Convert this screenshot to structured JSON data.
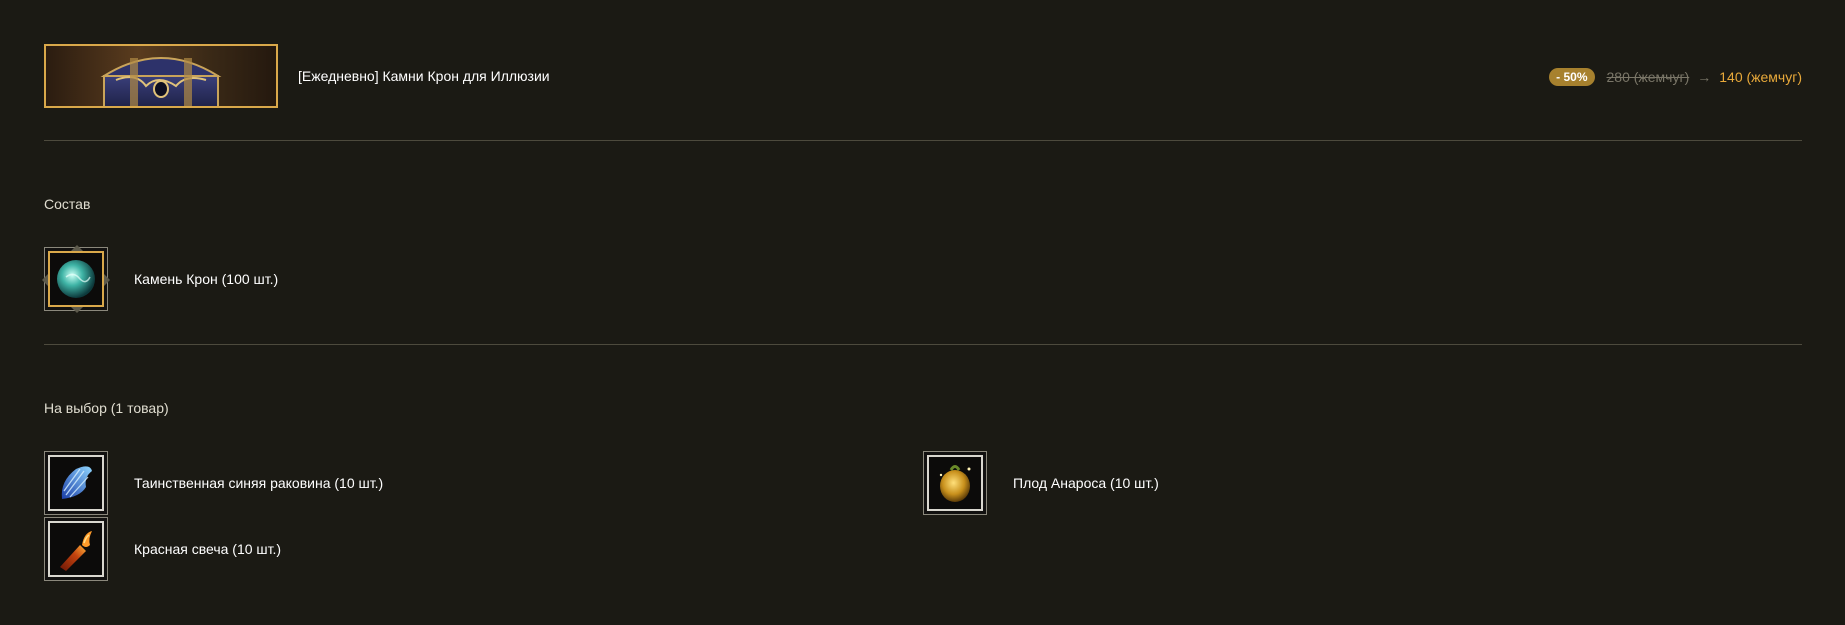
{
  "header": {
    "title": "[Ежедневно] Камни Крон для Иллюзии",
    "discount_badge": "- 50%",
    "old_price": "280 (жемчуг)",
    "arrow": "→",
    "new_price": "140 (жемчуг)",
    "banner_icon": "treasure-chest-icon"
  },
  "composition": {
    "title": "Состав",
    "items": [
      {
        "label": "Камень Крон (100 шт.)",
        "icon": "kron-stone-icon"
      }
    ]
  },
  "choice": {
    "title": "На выбор (1 товар)",
    "items": [
      {
        "label": "Таинственная синяя раковина (10 шт.)",
        "icon": "blue-shell-icon"
      },
      {
        "label": "Плод Анароса (10 шт.)",
        "icon": "anaros-fruit-icon"
      },
      {
        "label": "Красная свеча (10 шт.)",
        "icon": "red-candle-icon"
      }
    ]
  },
  "colors": {
    "background": "#1b1a14",
    "accent_gold": "#d9a84a",
    "new_price": "#e8a93a",
    "badge": "#a7812e",
    "divider": "#4d4a3d"
  }
}
